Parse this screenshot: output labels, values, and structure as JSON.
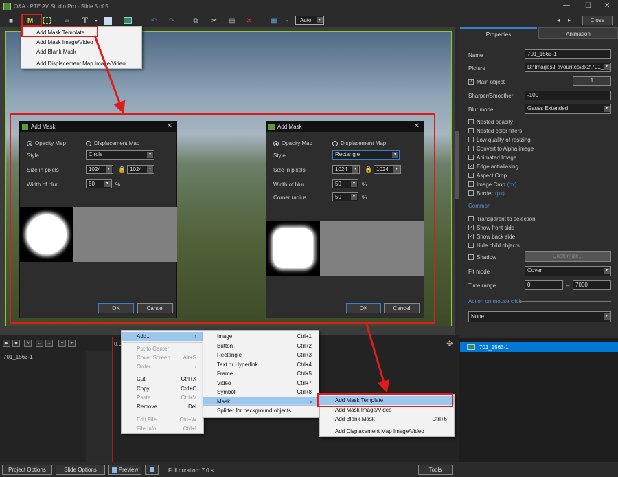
{
  "window": {
    "title": "O&A - PTE AV Studio Pro - Slide 5 of 5",
    "minimize": "—",
    "maximize": "☐",
    "close": "✕",
    "prev": "◂",
    "next": "▸",
    "close_button": "Close"
  },
  "toolbar": {
    "zoom_select": "Auto",
    "icons": [
      "camera-icon",
      "mask-icon",
      "frame-icon",
      "button-icon",
      "text-icon",
      "rectangle-icon",
      "image-icon",
      "undo-icon",
      "redo-icon",
      "copy-icon",
      "cut-icon",
      "paste-icon",
      "delete-icon",
      "grid-icon"
    ],
    "mask_letter": "M",
    "text_letter": "T"
  },
  "mask_menu": {
    "items": [
      "Add Mask Template",
      "Add Mask Image/Video",
      "Add Blank Mask",
      "Add Displacement Map Image/Video"
    ]
  },
  "dialog_circle": {
    "title": "Add Mask",
    "opacity_map": "Opacity Map",
    "displacement_map": "Displacement Map",
    "style_label": "Style",
    "style_value": "Circle",
    "size_label": "Size in pixels",
    "width": "1024",
    "height": "1024",
    "blur_label": "Width of blur",
    "blur_value": "50",
    "percent": "%",
    "ok": "OK",
    "cancel": "Cancel"
  },
  "dialog_rect": {
    "title": "Add Mask",
    "opacity_map": "Opacity Map",
    "displacement_map": "Displacement Map",
    "style_label": "Style",
    "style_value": "Rectangle",
    "size_label": "Size in pixels",
    "width": "1024",
    "height": "1024",
    "blur_label": "Width of blur",
    "blur_value": "50",
    "corner_label": "Corner radius",
    "corner_value": "50",
    "percent": "%",
    "ok": "OK",
    "cancel": "Cancel"
  },
  "properties": {
    "tabs": [
      "Properties",
      "Animation"
    ],
    "name_label": "Name",
    "name_value": "701_1563-1",
    "picture_label": "Picture",
    "picture_value": "D:\\Images\\Favourites\\3x2\\701_156",
    "main_object": "Main object",
    "main_object_value": "1",
    "sharper_label": "Sharper/Smoother",
    "sharper_value": "-100",
    "blur_label": "Blur mode",
    "blur_value": "Gauss Extended",
    "checkboxes": [
      {
        "label": "Nested opacity",
        "checked": false
      },
      {
        "label": "Nested color filters",
        "checked": false
      },
      {
        "label": "Low quality of resizing",
        "checked": false
      },
      {
        "label": "Convert to Alpha image",
        "checked": false
      },
      {
        "label": "Animated Image",
        "checked": false
      },
      {
        "label": "Edge antialiasing",
        "checked": true
      },
      {
        "label": "Aspect Crop",
        "checked": false
      },
      {
        "label": "Image Crop",
        "checked": false,
        "suffix": "(px)"
      },
      {
        "label": "Border",
        "checked": false,
        "suffix": "(px)"
      }
    ],
    "common_label": "Common",
    "common_checkboxes": [
      {
        "label": "Transparent to selection",
        "checked": false
      },
      {
        "label": "Show front side",
        "checked": true
      },
      {
        "label": "Show back side",
        "checked": true
      },
      {
        "label": "Hide child objects",
        "checked": false
      }
    ],
    "shadow_label": "Shadow",
    "customize": "Customize...",
    "fit_label": "Fit mode",
    "fit_value": "Cover",
    "time_label": "Time range",
    "time_from": "0",
    "time_sep": "–",
    "time_to": "7000",
    "action_label": "Action on mouse click",
    "action_value": "None"
  },
  "object_list": {
    "items": [
      "701_1563-1"
    ]
  },
  "timeline": {
    "time": "0.0",
    "track": "701_1563-1",
    "buttons": [
      "▶",
      "■",
      "⅟",
      "←",
      "→",
      "−",
      "+"
    ]
  },
  "context_menu": {
    "items": [
      {
        "label": "Add...",
        "shortcut": "›",
        "state": "highlight"
      },
      {
        "label": "Put to Center",
        "shortcut": "",
        "state": "disabled"
      },
      {
        "label": "Cover Screen",
        "shortcut": "Alt+S",
        "state": "disabled"
      },
      {
        "label": "Order",
        "shortcut": "›",
        "state": "disabled"
      },
      {
        "label": "Cut",
        "shortcut": "Ctrl+X",
        "state": ""
      },
      {
        "label": "Copy",
        "shortcut": "Ctrl+C",
        "state": ""
      },
      {
        "label": "Paste",
        "shortcut": "Ctrl+V",
        "state": "disabled"
      },
      {
        "label": "Remove",
        "shortcut": "Del",
        "state": ""
      },
      {
        "label": "Edit File",
        "shortcut": "Ctrl+W",
        "state": "disabled"
      },
      {
        "label": "File Info",
        "shortcut": "Ctrl+I",
        "state": "disabled"
      }
    ]
  },
  "add_submenu": {
    "items": [
      {
        "label": "Image",
        "shortcut": "Ctrl+1"
      },
      {
        "label": "Button",
        "shortcut": "Ctrl+2"
      },
      {
        "label": "Rectangle",
        "shortcut": "Ctrl+3"
      },
      {
        "label": "Text or Hyperlink",
        "shortcut": "Ctrl+4"
      },
      {
        "label": "Frame",
        "shortcut": "Ctrl+5"
      },
      {
        "label": "Video",
        "shortcut": "Ctrl+7"
      },
      {
        "label": "Symbol",
        "shortcut": "Ctrl+8"
      },
      {
        "label": "Mask",
        "shortcut": "›"
      },
      {
        "label": "Splitter for background objects",
        "shortcut": ""
      }
    ]
  },
  "mask_submenu": {
    "items": [
      {
        "label": "Add Mask Template",
        "shortcut": ""
      },
      {
        "label": "Add Mask Image/Video",
        "shortcut": ""
      },
      {
        "label": "Add Blank Mask",
        "shortcut": "Ctrl+6"
      },
      {
        "label": "Add Displacement Map Image/Video",
        "shortcut": ""
      }
    ]
  },
  "bottom": {
    "project_options": "Project Options",
    "slide_options": "Slide Options",
    "preview": "Preview",
    "duration": "Full duration: 7.0 s",
    "tools": "Tools"
  },
  "colors": {
    "accent": "#e01b1b",
    "selection": "#0078d7",
    "menu_highlight": "#9cc8f0"
  }
}
